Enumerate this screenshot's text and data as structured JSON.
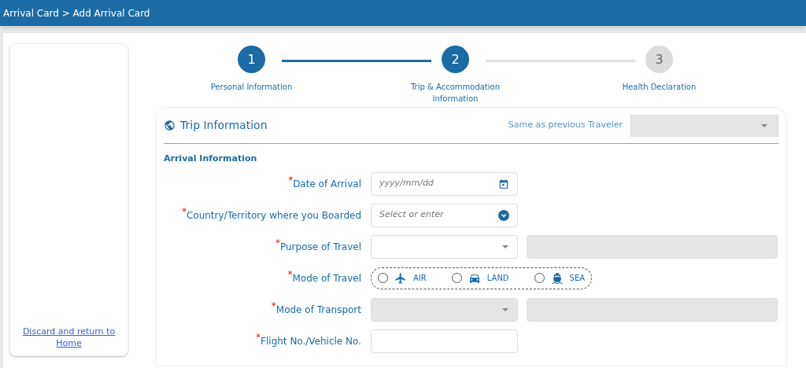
{
  "header": {
    "breadcrumb": "Arrival Card > Add Arrival Card"
  },
  "sidebar": {
    "link": "Discard and return to Home"
  },
  "steps": [
    {
      "number": "1",
      "label": "Personal Information",
      "reached": true
    },
    {
      "number": "2",
      "label": "Trip & Accommodation Information",
      "reached": true
    },
    {
      "number": "3",
      "label": "Health Declaration",
      "reached": false
    }
  ],
  "section": {
    "title": "Trip Information",
    "same_as_label": "Same as previous Traveler",
    "same_as_disabled": true,
    "subtitle": "Arrival Information"
  },
  "fields": [
    {
      "kind": "date",
      "mark": "*",
      "label": "Date of Arrival",
      "placeholder": "yyyy/mm/dd"
    },
    {
      "kind": "combo",
      "mark": "*",
      "label": "Country/Territory where you Boarded",
      "placeholder": "Select or enter"
    },
    {
      "kind": "select",
      "mark": "*",
      "label": "Purpose of Travel",
      "disabled": false,
      "extra": true
    },
    {
      "kind": "radio",
      "mark": "*",
      "label": "Mode of Travel",
      "options": [
        {
          "label": "AIR",
          "selected": false
        },
        {
          "label": "LAND",
          "selected": false
        },
        {
          "label": "SEA",
          "selected": false
        }
      ]
    },
    {
      "kind": "select",
      "mark": "*",
      "label": "Mode of Transport",
      "disabled": true,
      "extra": true
    },
    {
      "kind": "text",
      "mark": "*",
      "label": "Flight No./Vehicle No."
    }
  ]
}
